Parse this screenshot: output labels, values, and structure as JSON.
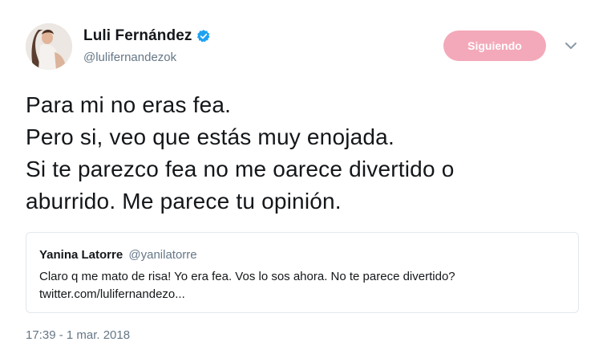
{
  "author": {
    "name": "Luli Fernández",
    "handle": "@lulifernandezok",
    "verified": true,
    "avatar_icon": "profile-photo"
  },
  "follow_button": {
    "label": "Siguiendo",
    "color": "#f3a9b9"
  },
  "menu_icon": "chevron-down-icon",
  "tweet": {
    "lines": [
      "Para mi no eras fea.",
      "Pero si, veo que estás muy enojada.",
      "Si te parezco fea no me oarece divertido o",
      "aburrido. Me parece tu opinión."
    ]
  },
  "quoted_tweet": {
    "name": "Yanina Latorre",
    "handle": "@yanilatorre",
    "text": "Claro q me mato de risa! Yo era fea. Vos lo sos ahora. No te parece divertido?",
    "link": "twitter.com/lulifernandezo..."
  },
  "timestamp": "17:39 - 1 mar. 2018",
  "colors": {
    "verified": "#1da1f2",
    "secondary_text": "#657786",
    "border": "#e1e8ed"
  }
}
